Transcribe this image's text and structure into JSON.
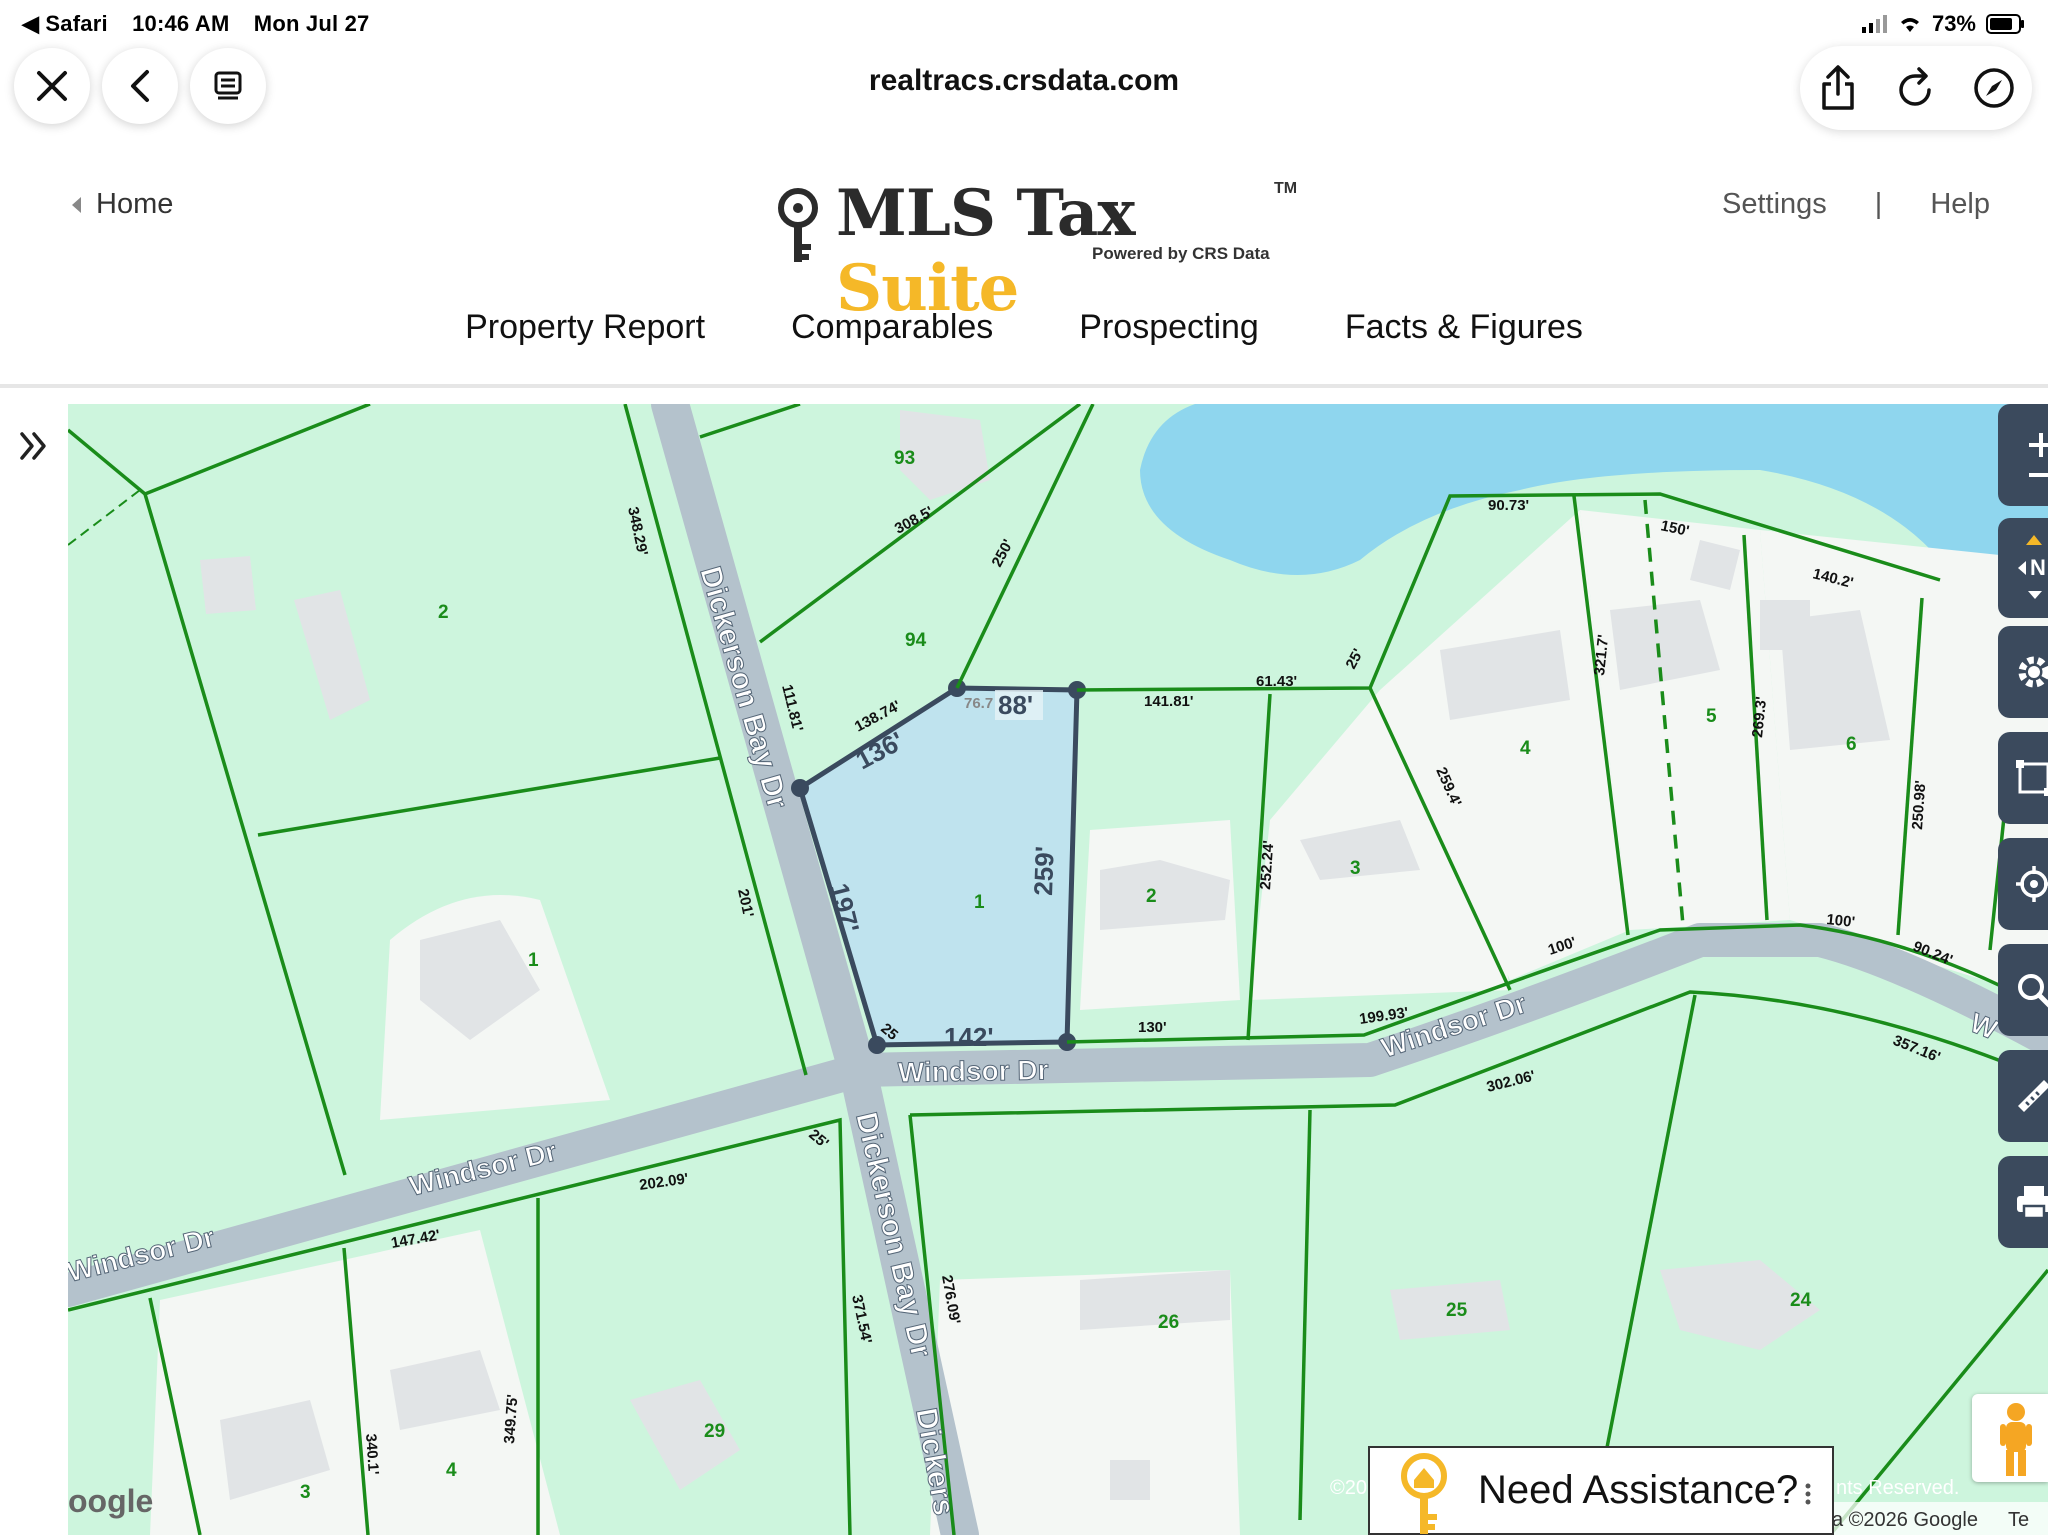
{
  "status_bar": {
    "back_app": "◀ Safari",
    "time": "10:46 AM",
    "date": "Mon Jul 27",
    "battery": "73%"
  },
  "browser": {
    "url": "realtracs.crsdata.com"
  },
  "site": {
    "home_label": "Home",
    "logo_mls": "MLS Tax ",
    "logo_suite": "Suite",
    "logo_tm": "TM",
    "logo_powered": "Powered by CRS Data",
    "settings_label": "Settings",
    "link_separator": "|",
    "help_label": "Help",
    "nav": [
      "Property Report",
      "Comparables",
      "Prospecting",
      "Facts & Figures"
    ]
  },
  "map": {
    "roads": [
      "Dickerson Bay Dr",
      "Dickerson Bay Dr",
      "Windsor Dr",
      "Windsor Dr",
      "Windsor Dr",
      "Windsor Dr",
      "Windsor Dr",
      "Dickers",
      "W"
    ],
    "lot_numbers": [
      "93",
      "94",
      "2",
      "1",
      "1",
      "2",
      "3",
      "4",
      "5",
      "6",
      "26",
      "25",
      "24",
      "29",
      "4",
      "3"
    ],
    "dimensions": [
      "348.29'",
      "308.5'",
      "250'",
      "111.81'",
      "138.74'",
      "76.7",
      "141.81'",
      "61.43'",
      "25'",
      "90.73'",
      "150'",
      "140.2'",
      "321.7'",
      "269.3'",
      "250.98'",
      "259.4'",
      "252.24'",
      "201'",
      "130'",
      "199.93'",
      "100'",
      "100'",
      "90.24'",
      "357.16'",
      "302.06'",
      "202.09'",
      "147.42'",
      "25'",
      "276.09'",
      "371.54'",
      "340.1'",
      "349.75'",
      "25"
    ],
    "selected_parcel": {
      "top": "88'",
      "northwest": "136'",
      "west": "197'",
      "east": "259'",
      "south": "142'"
    },
    "copyright_left": "©20",
    "copyright_right": "nts Reserved.",
    "copyright_google": "a ©2026 Google",
    "terms": "Te",
    "google": "oogle"
  },
  "assist": {
    "label": "Need Assistance?"
  },
  "colors": {
    "parcel_line": "#1a8c1a",
    "parcel_fill": "#cdf5dd",
    "water": "#8fd6ee",
    "road": "#b4c2cc",
    "selected": "#bfe3ee",
    "toolbar": "#3b4a5d",
    "suite_yellow": "#f5b828"
  }
}
